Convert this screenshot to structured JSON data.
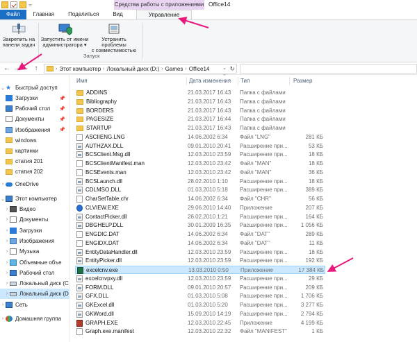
{
  "window": {
    "context_group": "Средства работы с приложениями",
    "title": "Office14"
  },
  "ribbon_tabs": {
    "file": "Файл",
    "home": "Главная",
    "share": "Поделиться",
    "view": "Вид",
    "manage": "Управление"
  },
  "ribbon": {
    "pin_taskbar": "Закрепить на панели задач",
    "pin_taskbar_l1": "Закрепить на",
    "pin_taskbar_l2": "панели задач",
    "run_admin_l1": "Запустить от имени",
    "run_admin_l2": "администратора ▾",
    "troubleshoot_l1": "Устранить проблемы",
    "troubleshoot_l2": "с совместимостью",
    "group_run": "Запуск"
  },
  "address": {
    "crumbs": [
      "Этот компьютер",
      "Локальный диск (D:)",
      "Games",
      "Office14"
    ]
  },
  "nav": {
    "quick_access": "Быстрый доступ",
    "items": [
      {
        "label": "Загрузки",
        "icon": "downloads-icon",
        "pinned": true
      },
      {
        "label": "Рабочий стол",
        "icon": "desktop-icon",
        "pinned": true
      },
      {
        "label": "Документы",
        "icon": "documents-icon",
        "pinned": true
      },
      {
        "label": "Изображения",
        "icon": "pictures-icon",
        "pinned": true
      },
      {
        "label": "windows",
        "icon": "folder-icon",
        "pinned": false
      },
      {
        "label": "картинки",
        "icon": "folder-icon",
        "pinned": false
      },
      {
        "label": "статия 201",
        "icon": "folder-icon",
        "pinned": false
      },
      {
        "label": "статия 202",
        "icon": "folder-icon",
        "pinned": false
      }
    ],
    "onedrive": "OneDrive",
    "this_pc": "Этот компьютер",
    "pc_items": [
      {
        "label": "Видео",
        "icon": "video-icon"
      },
      {
        "label": "Документы",
        "icon": "documents-icon"
      },
      {
        "label": "Загрузки",
        "icon": "downloads-icon"
      },
      {
        "label": "Изображения",
        "icon": "pictures-icon"
      },
      {
        "label": "Музыка",
        "icon": "music-icon"
      },
      {
        "label": "Объемные объе",
        "icon": "3d-objects-icon"
      },
      {
        "label": "Рабочий стол",
        "icon": "desktop-icon"
      },
      {
        "label": "Локальный диск (C",
        "icon": "drive-icon"
      },
      {
        "label": "Локальный диск (D",
        "icon": "drive-icon"
      }
    ],
    "network": "Сеть",
    "homegroup": "Домашняя группа"
  },
  "columns": {
    "name": "Имя",
    "date": "Дата изменения",
    "type": "Тип",
    "size": "Размер"
  },
  "files": [
    {
      "name": "ADDINS",
      "date": "21.03.2017 16:43",
      "type": "Папка с файлами",
      "size": "",
      "kind": "folder"
    },
    {
      "name": "Bibliography",
      "date": "21.03.2017 16:43",
      "type": "Папка с файлами",
      "size": "",
      "kind": "folder"
    },
    {
      "name": "BORDERS",
      "date": "21.03.2017 16:43",
      "type": "Папка с файлами",
      "size": "",
      "kind": "folder"
    },
    {
      "name": "PAGESIZE",
      "date": "21.03.2017 16:44",
      "type": "Папка с файлами",
      "size": "",
      "kind": "folder"
    },
    {
      "name": "STARTUP",
      "date": "21.03.2017 16:43",
      "type": "Папка с файлами",
      "size": "",
      "kind": "folder"
    },
    {
      "name": "ASCIIENG.LNG",
      "date": "14.06.2002 6:34",
      "type": "Файл \"LNG\"",
      "size": "281 КБ",
      "kind": "file"
    },
    {
      "name": "AUTHZAX.DLL",
      "date": "09.01.2010 20:41",
      "type": "Расширение при...",
      "size": "53 КБ",
      "kind": "dll"
    },
    {
      "name": "BCSClient.Msg.dll",
      "date": "12.03.2010 23:59",
      "type": "Расширение при...",
      "size": "18 КБ",
      "kind": "dll"
    },
    {
      "name": "BCSClientManifest.man",
      "date": "12.03.2010 23:42",
      "type": "Файл \"MAN\"",
      "size": "18 КБ",
      "kind": "file"
    },
    {
      "name": "BCSEvents.man",
      "date": "12.03.2010 23:42",
      "type": "Файл \"MAN\"",
      "size": "36 КБ",
      "kind": "file"
    },
    {
      "name": "BCSLaunch.dll",
      "date": "28.02.2010 1:10",
      "type": "Расширение при...",
      "size": "18 КБ",
      "kind": "dll"
    },
    {
      "name": "CDLMSO.DLL",
      "date": "01.03.2010 5:18",
      "type": "Расширение при...",
      "size": "389 КБ",
      "kind": "dll"
    },
    {
      "name": "CharSetTable.chr",
      "date": "14.06.2002 6:34",
      "type": "Файл \"CHR\"",
      "size": "56 КБ",
      "kind": "file"
    },
    {
      "name": "CLVIEW.EXE",
      "date": "29.06.2010 14:40",
      "type": "Приложение",
      "size": "207 КБ",
      "kind": "help"
    },
    {
      "name": "ContactPicker.dll",
      "date": "28.02.2010 1:21",
      "type": "Расширение при...",
      "size": "164 КБ",
      "kind": "dll"
    },
    {
      "name": "DBGHELP.DLL",
      "date": "30.01.2009 16:35",
      "type": "Расширение при...",
      "size": "1 056 КБ",
      "kind": "dll"
    },
    {
      "name": "ENGDIC.DAT",
      "date": "14.06.2002 6:34",
      "type": "Файл \"DAT\"",
      "size": "289 КБ",
      "kind": "file"
    },
    {
      "name": "ENGIDX.DAT",
      "date": "14.06.2002 6:34",
      "type": "Файл \"DAT\"",
      "size": "11 КБ",
      "kind": "file"
    },
    {
      "name": "EntityDataHandler.dll",
      "date": "12.03.2010 23:59",
      "type": "Расширение при...",
      "size": "18 КБ",
      "kind": "dll"
    },
    {
      "name": "EntityPicker.dll",
      "date": "12.03.2010 23:59",
      "type": "Расширение при...",
      "size": "192 КБ",
      "kind": "dll"
    },
    {
      "name": "excelcnv.exe",
      "date": "13.03.2010 0:50",
      "type": "Приложение",
      "size": "17 384 КБ",
      "kind": "excel",
      "selected": true
    },
    {
      "name": "excelcnvpxy.dll",
      "date": "12.03.2010 23:59",
      "type": "Расширение при...",
      "size": "29 КБ",
      "kind": "dll"
    },
    {
      "name": "FORM.DLL",
      "date": "09.01.2010 20:57",
      "type": "Расширение при...",
      "size": "209 КБ",
      "kind": "dll"
    },
    {
      "name": "GFX.DLL",
      "date": "01.03.2010 5:08",
      "type": "Расширение при...",
      "size": "1 706 КБ",
      "kind": "dll"
    },
    {
      "name": "GKExcel.dll",
      "date": "01.03.2010 5:20",
      "type": "Расширение при...",
      "size": "3 277 КБ",
      "kind": "dll"
    },
    {
      "name": "GKWord.dll",
      "date": "15.09.2010 14:19",
      "type": "Расширение при...",
      "size": "2 794 КБ",
      "kind": "dll"
    },
    {
      "name": "GRAPH.EXE",
      "date": "12.03.2010 22:45",
      "type": "Приложение",
      "size": "4 199 КБ",
      "kind": "graph"
    },
    {
      "name": "Graph.exe.manifest",
      "date": "12.03.2010 22:32",
      "type": "Файл \"MANIFEST\"",
      "size": "1 КБ",
      "kind": "file"
    }
  ]
}
